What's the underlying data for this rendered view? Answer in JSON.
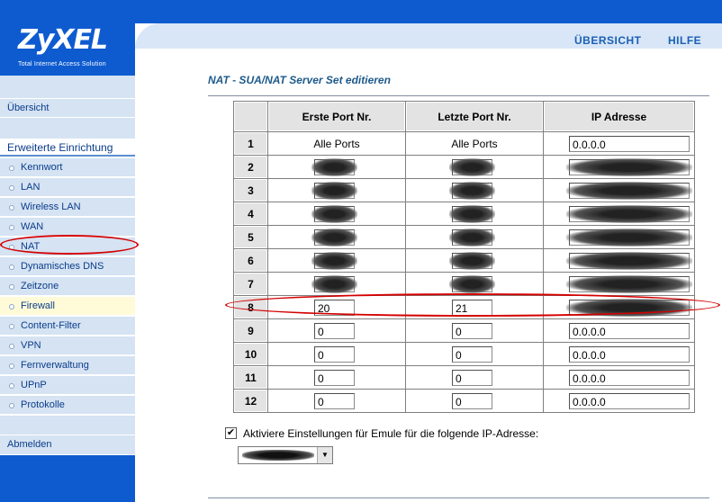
{
  "brand": {
    "logo": "ZyXEL",
    "tagline": "Total Internet Access Solution"
  },
  "top_nav": {
    "overview": "ÜBERSICHT",
    "help": "HILFE"
  },
  "sidebar": {
    "overview": "Übersicht",
    "section": "Erweiterte Einrichtung",
    "items": [
      "Kennwort",
      "LAN",
      "Wireless LAN",
      "WAN",
      "NAT",
      "Dynamisches DNS",
      "Zeitzone",
      "Firewall",
      "Content-Filter",
      "VPN",
      "Fernverwaltung",
      "UPnP",
      "Protokolle"
    ],
    "logout": "Abmelden",
    "highlighted": "Firewall"
  },
  "page": {
    "title": "NAT - SUA/NAT Server Set editieren"
  },
  "table": {
    "headers": [
      "Erste Port Nr.",
      "Letzte Port Nr.",
      "IP Adresse"
    ],
    "rows": [
      {
        "num": "1",
        "first": "Alle Ports",
        "last": "Alle Ports",
        "ip": "0.0.0.0",
        "editable_ports": false,
        "redacted": false
      },
      {
        "num": "2",
        "first": "",
        "last": "",
        "ip": "",
        "redacted": true
      },
      {
        "num": "3",
        "first": "",
        "last": "",
        "ip": "",
        "redacted": true
      },
      {
        "num": "4",
        "first": "",
        "last": "",
        "ip": "",
        "redacted": true
      },
      {
        "num": "5",
        "first": "",
        "last": "",
        "ip": "",
        "redacted": true
      },
      {
        "num": "6",
        "first": "",
        "last": "",
        "ip": "",
        "redacted": true
      },
      {
        "num": "7",
        "first": "",
        "last": "",
        "ip": "",
        "redacted": true
      },
      {
        "num": "8",
        "first": "20",
        "last": "21",
        "ip": "",
        "redacted_ip": true
      },
      {
        "num": "9",
        "first": "0",
        "last": "0",
        "ip": "0.0.0.0"
      },
      {
        "num": "10",
        "first": "0",
        "last": "0",
        "ip": "0.0.0.0"
      },
      {
        "num": "11",
        "first": "0",
        "last": "0",
        "ip": "0.0.0.0"
      },
      {
        "num": "12",
        "first": "0",
        "last": "0",
        "ip": "0.0.0.0"
      }
    ]
  },
  "emule": {
    "checked": true,
    "label": "Aktiviere Einstellungen für Emule für die folgende IP-Adresse:",
    "check_mark": "✔",
    "dropdown_arrow": "▼"
  },
  "colors": {
    "brand_blue": "#0e5bd0",
    "nav_bg": "#d5e3f3",
    "annotation_red": "#d40000"
  }
}
